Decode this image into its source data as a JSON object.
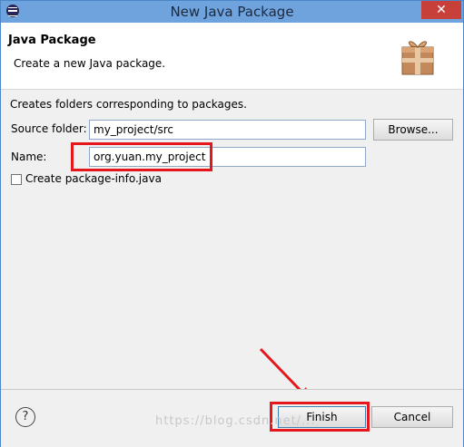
{
  "window": {
    "title": "New Java Package",
    "close_glyph": "✕"
  },
  "header": {
    "title": "Java Package",
    "description": "Create a new Java package."
  },
  "form": {
    "hint": "Creates folders corresponding to packages.",
    "source_folder_label": "Source folder:",
    "source_folder_value": "my_project/src",
    "browse_label": "Browse...",
    "name_label": "Name:",
    "name_value": "org.yuan.my_project",
    "create_package_info_label": "Create package-info.java",
    "create_package_info_checked": false
  },
  "footer": {
    "help_glyph": "?",
    "finish_label": "Finish",
    "cancel_label": "Cancel"
  },
  "watermark": "https://blog.csdn.net/...",
  "colors": {
    "annotation_red": "#e5161c",
    "title_bar": "#6fa3dd"
  }
}
